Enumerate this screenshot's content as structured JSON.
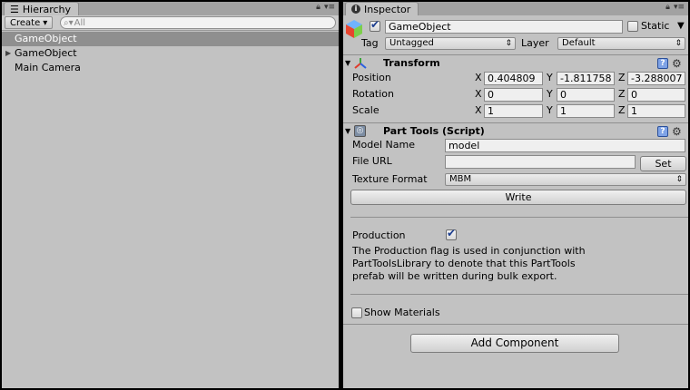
{
  "hierarchy": {
    "tab_label": "Hierarchy",
    "tab_icon": "list-icon",
    "create_label": "Create",
    "search_placeholder": "All",
    "items": [
      {
        "label": "GameObject",
        "selected": true,
        "has_children": false
      },
      {
        "label": "GameObject",
        "selected": false,
        "has_children": true
      },
      {
        "label": "Main Camera",
        "selected": false,
        "has_children": false
      }
    ]
  },
  "inspector": {
    "tab_label": "Inspector",
    "tab_icon": "info-icon",
    "object_name": "GameObject",
    "active": true,
    "static_label": "Static",
    "static_checked": false,
    "tag_label": "Tag",
    "tag_value": "Untagged",
    "layer_label": "Layer",
    "layer_value": "Default",
    "transform": {
      "title": "Transform",
      "rows": [
        {
          "label": "Position",
          "x": "0.404809",
          "y": "-1.811758",
          "z": "-3.288007"
        },
        {
          "label": "Rotation",
          "x": "0",
          "y": "0",
          "z": "0"
        },
        {
          "label": "Scale",
          "x": "1",
          "y": "1",
          "z": "1"
        }
      ],
      "axis_x": "X",
      "axis_y": "Y",
      "axis_z": "Z"
    },
    "part_tools": {
      "title": "Part Tools (Script)",
      "model_name_label": "Model Name",
      "model_name_value": "model",
      "file_url_label": "File URL",
      "file_url_value": "",
      "set_label": "Set",
      "texture_format_label": "Texture Format",
      "texture_format_value": "MBM",
      "write_label": "Write",
      "production_label": "Production",
      "production_checked": true,
      "production_help": "The Production flag is used in conjunction with PartToolsLibrary to denote that this PartTools prefab will be written during bulk export.",
      "show_materials_label": "Show Materials",
      "show_materials_checked": false
    },
    "add_component_label": "Add Component"
  }
}
